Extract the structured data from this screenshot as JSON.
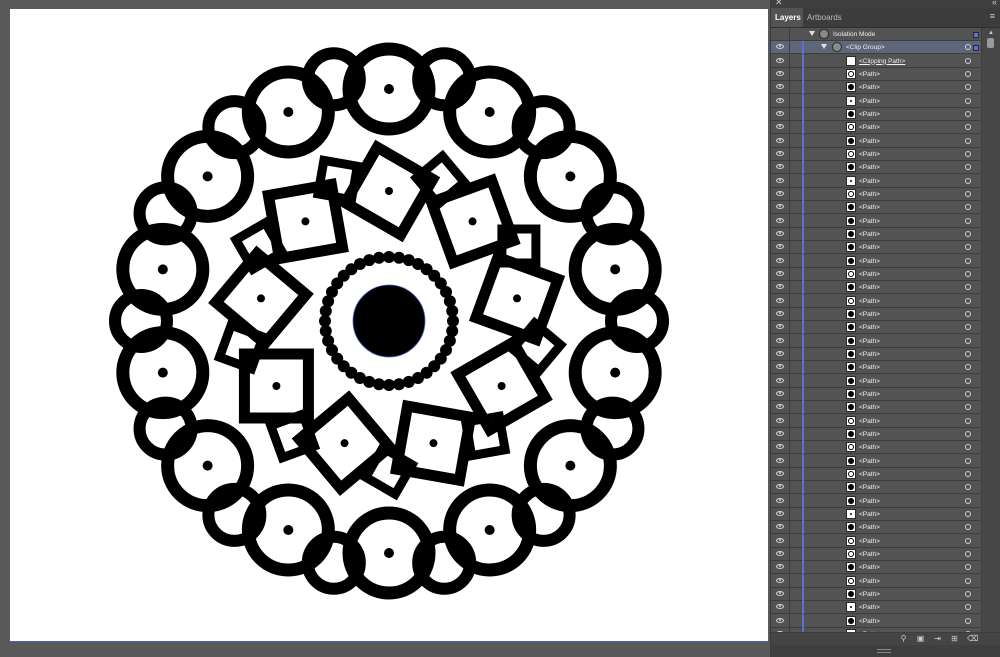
{
  "panel": {
    "tabs": [
      {
        "label": "Layers",
        "active": true
      },
      {
        "label": "Artboards",
        "active": false
      }
    ],
    "rows": [
      {
        "label": "Isolation Mode",
        "type": "isolation"
      },
      {
        "label": "<Clip Group>",
        "type": "group",
        "selected": true
      },
      {
        "label": "<Clipping Path>",
        "type": "clip"
      },
      {
        "label": "<Path>",
        "thumb": "ring"
      },
      {
        "label": "<Path>",
        "thumb": "dark"
      },
      {
        "label": "<Path>",
        "thumb": "dot"
      },
      {
        "label": "<Path>",
        "thumb": "dark"
      },
      {
        "label": "<Path>",
        "thumb": "ring"
      },
      {
        "label": "<Path>",
        "thumb": "dark"
      },
      {
        "label": "<Path>",
        "thumb": "ring"
      },
      {
        "label": "<Path>",
        "thumb": "dark"
      },
      {
        "label": "<Path>",
        "thumb": "dot"
      },
      {
        "label": "<Path>",
        "thumb": "ring"
      },
      {
        "label": "<Path>",
        "thumb": "dark"
      },
      {
        "label": "<Path>",
        "thumb": "dark"
      },
      {
        "label": "<Path>",
        "thumb": "dark"
      },
      {
        "label": "<Path>",
        "thumb": "dark"
      },
      {
        "label": "<Path>",
        "thumb": "dark"
      },
      {
        "label": "<Path>",
        "thumb": "ring"
      },
      {
        "label": "<Path>",
        "thumb": "dark"
      },
      {
        "label": "<Path>",
        "thumb": "ring"
      },
      {
        "label": "<Path>",
        "thumb": "dark"
      },
      {
        "label": "<Path>",
        "thumb": "dark"
      },
      {
        "label": "<Path>",
        "thumb": "dark"
      },
      {
        "label": "<Path>",
        "thumb": "dark"
      },
      {
        "label": "<Path>",
        "thumb": "dark"
      },
      {
        "label": "<Path>",
        "thumb": "dark"
      },
      {
        "label": "<Path>",
        "thumb": "dark"
      },
      {
        "label": "<Path>",
        "thumb": "dark"
      },
      {
        "label": "<Path>",
        "thumb": "ring"
      },
      {
        "label": "<Path>",
        "thumb": "dark"
      },
      {
        "label": "<Path>",
        "thumb": "ring"
      },
      {
        "label": "<Path>",
        "thumb": "dark"
      },
      {
        "label": "<Path>",
        "thumb": "ring"
      },
      {
        "label": "<Path>",
        "thumb": "dark"
      },
      {
        "label": "<Path>",
        "thumb": "dark"
      },
      {
        "label": "<Path>",
        "thumb": "dot"
      },
      {
        "label": "<Path>",
        "thumb": "dark"
      },
      {
        "label": "<Path>",
        "thumb": "ring"
      },
      {
        "label": "<Path>",
        "thumb": "ring"
      },
      {
        "label": "<Path>",
        "thumb": "dark"
      },
      {
        "label": "<Path>",
        "thumb": "ring"
      },
      {
        "label": "<Path>",
        "thumb": "dark"
      },
      {
        "label": "<Path>",
        "thumb": "dot"
      },
      {
        "label": "<Path>",
        "thumb": "dark"
      },
      {
        "label": "<Path>",
        "thumb": "dot"
      }
    ],
    "footer_icons": [
      "search-icon",
      "clip-mask-icon",
      "sublayer-icon",
      "new-layer-icon",
      "trash-icon"
    ]
  },
  "colors": {
    "selection_blue": "#5d6fd8",
    "panel_bg": "#535353",
    "selected_row": "#5d6779"
  }
}
